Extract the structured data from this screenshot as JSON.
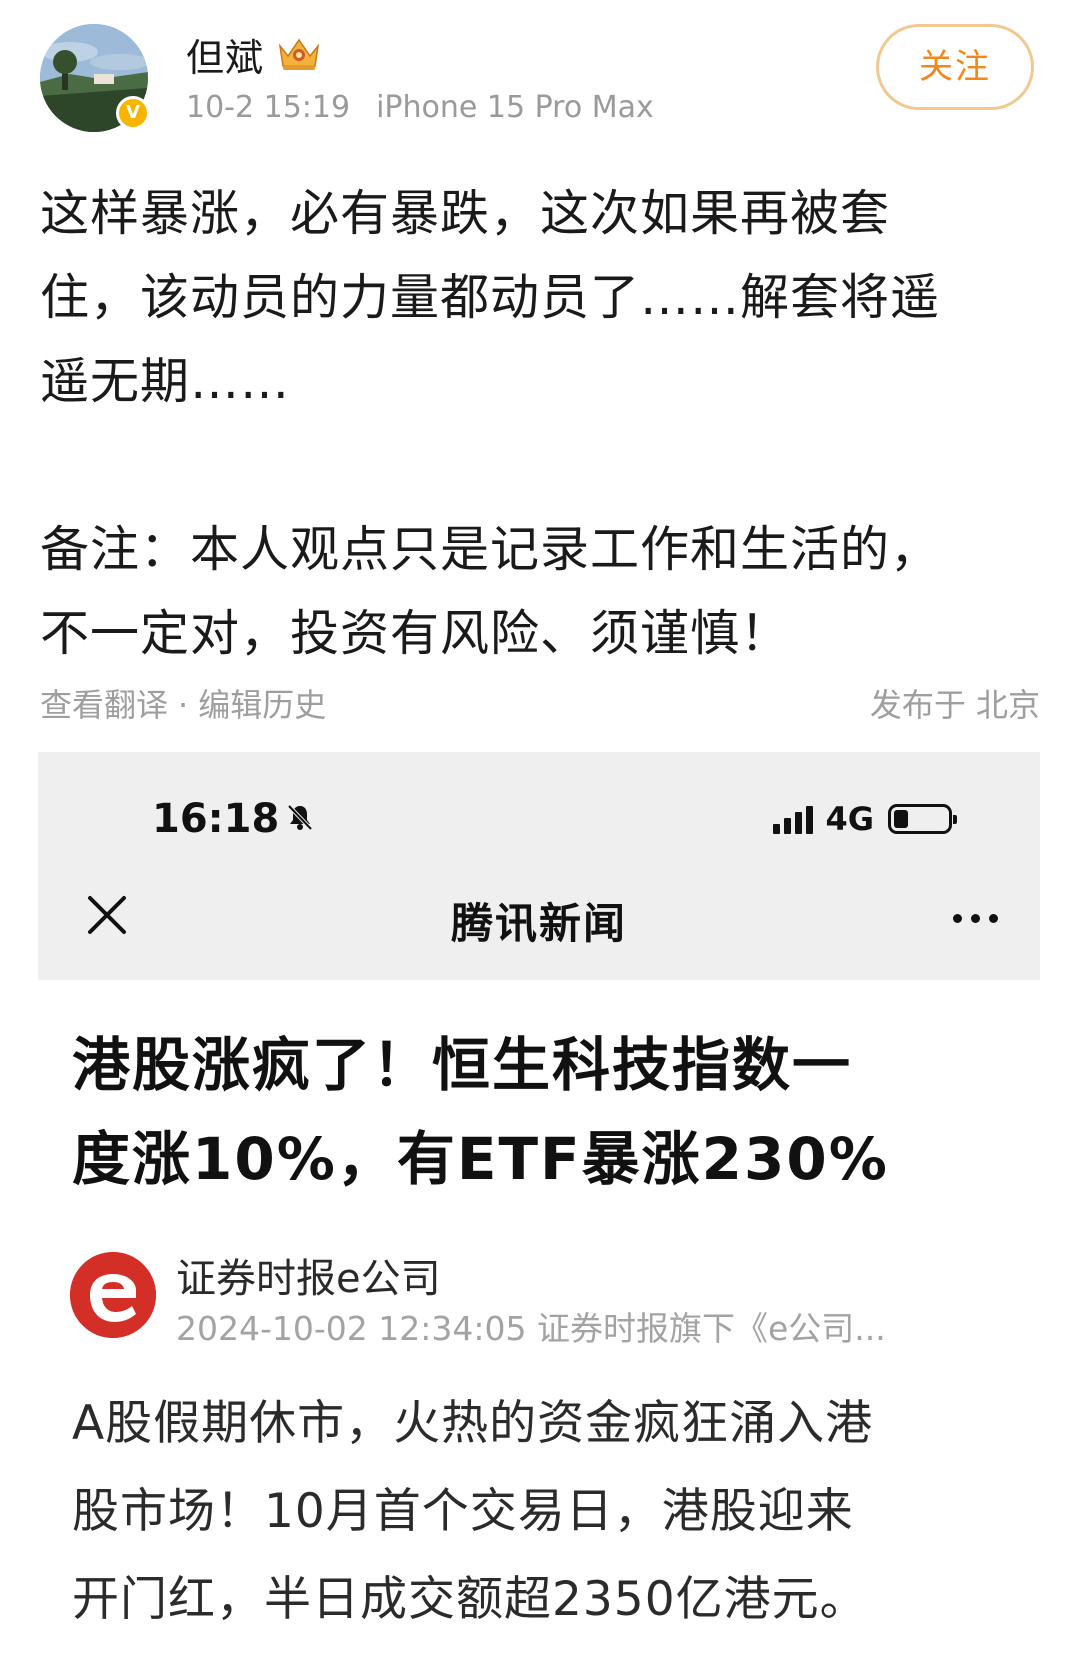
{
  "post": {
    "username": "但斌",
    "verified_badge": "V",
    "timestamp": "10-2 15:19",
    "device": "iPhone 15 Pro Max",
    "follow_label": "关注",
    "body_lines": [
      "这样暴涨，必有暴跌，这次如果再被套",
      "住，该动员的力量都动员了……解套将遥",
      "遥无期……"
    ],
    "note_lines": [
      "备注：本人观点只是记录工作和生活的，",
      "不一定对，投资有风险、须谨慎！"
    ],
    "footer": {
      "translate_link": "查看翻译",
      "separator": "·",
      "edit_history_link": "编辑历史",
      "location": "发布于 北京"
    }
  },
  "embedded": {
    "status_bar": {
      "time": "16:18",
      "network": "4G",
      "icons": [
        "bell-slash-icon",
        "signal-icon",
        "battery-icon"
      ]
    },
    "nav": {
      "title": "腾讯新闻",
      "close_icon": "close-icon",
      "more_icon": "more-icon"
    },
    "article": {
      "title_lines": [
        "港股涨疯了！恒生科技指数一",
        "度涨10%，有ETF暴涨230%"
      ],
      "source_name": "证券时报e公司",
      "source_meta": "2024-10-02 12:34:05 证券时报旗下《e公司...",
      "body_lines": [
        "A股假期休市，火热的资金疯狂涌入港",
        "股市场！10月首个交易日，港股迎来",
        "开门红，半日成交额超2350亿港元。"
      ]
    }
  },
  "colors": {
    "accent_orange": "#f2881a",
    "follow_border": "#f0c890",
    "verified_gold": "#f7b500",
    "source_logo_red": "#d42f27",
    "meta_gray": "#9a9a9a",
    "embed_bar_bg": "#efefef"
  }
}
